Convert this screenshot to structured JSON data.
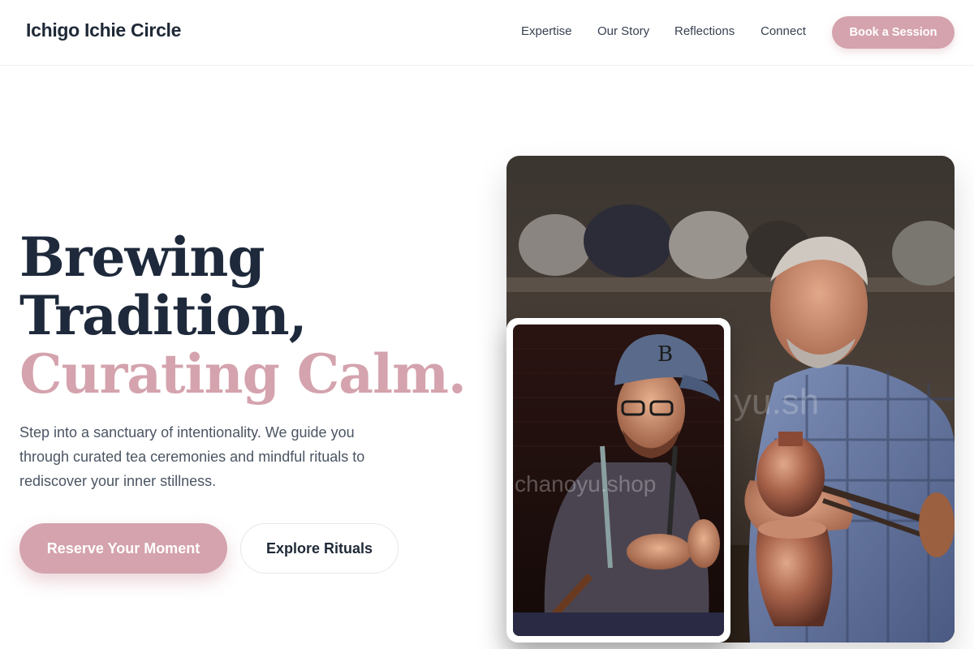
{
  "header": {
    "brand": "Ichigo Ichie Circle",
    "nav": [
      "Expertise",
      "Our Story",
      "Reflections",
      "Connect"
    ],
    "cta": "Book a Session"
  },
  "hero": {
    "headline_line1": "Brewing",
    "headline_line2": "Tradition,",
    "headline_line3": "Curating Calm.",
    "lead": "Step into a sanctuary of intentionality. We guide you through curated tea ceremonies and mindful rituals to rediscover your inner stillness.",
    "primary_button": "Reserve Your Moment",
    "secondary_button": "Explore Rituals"
  },
  "images": {
    "main_photo": "craftsman-working-copper-pot",
    "inset_photo": "artisan-with-cap-working",
    "watermark": "chanoyu.shop"
  },
  "colors": {
    "accent": "#d4a3ad",
    "heading": "#1e293b",
    "body": "#4b5563"
  }
}
